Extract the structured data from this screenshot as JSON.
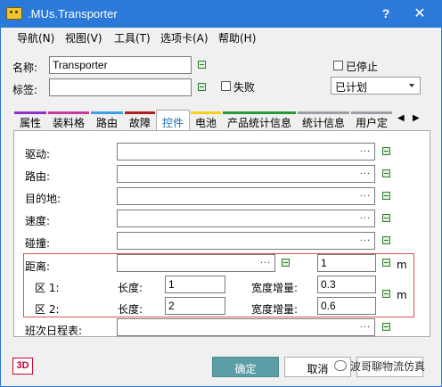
{
  "window": {
    "title": ".MUs.Transporter",
    "help_label": "?",
    "close_label": "✕"
  },
  "menu": [
    {
      "label": "导航(N)"
    },
    {
      "label": "视图(V)"
    },
    {
      "label": "工具(T)"
    },
    {
      "label": "选项卡(A)"
    },
    {
      "label": "帮助(H)"
    }
  ],
  "form": {
    "name_label": "名称:",
    "name_value": "Transporter",
    "tag_label": "标签:",
    "tag_value": "",
    "failed_label": "失败",
    "stopped_label": "已停止",
    "plan_value": "已计划"
  },
  "tabs": [
    {
      "label": "属性",
      "color": "#8e2fc9"
    },
    {
      "label": "装料格",
      "color": "#c83a9c"
    },
    {
      "label": "路由",
      "color": "#3ea0e8"
    },
    {
      "label": "故障",
      "color": "#b02020"
    },
    {
      "label": "控件",
      "color": "",
      "active": true
    },
    {
      "label": "电池",
      "color": "#f2d21b"
    },
    {
      "label": "产品统计信息",
      "color": "#2b9a3a"
    },
    {
      "label": "统计信息",
      "color": "#9aa0a6"
    },
    {
      "label": "用户定",
      "color": "#9aa0a6"
    }
  ],
  "tab_nav": {
    "prev": "◀",
    "next": "▶"
  },
  "controls": {
    "drive_label": "驱动:",
    "route_label": "路由:",
    "destination_label": "目的地:",
    "speed_label": "速度:",
    "collision_label": "碰撞:",
    "distance_label": "距离:",
    "distance_value": "1",
    "distance_unit": "m",
    "zone1_label": "区 1:",
    "zone1_length_label": "长度:",
    "zone1_length_value": "1",
    "zone1_width_label": "宽度增量:",
    "zone1_width_value": "0.3",
    "zone2_label": "区 2:",
    "zone2_length_label": "长度:",
    "zone2_length_value": "2",
    "zone2_width_label": "宽度增量:",
    "zone2_width_value": "0.6",
    "zones_unit": "m",
    "shift_label": "班次日程表:",
    "dots": "..."
  },
  "footer": {
    "badge": "3D",
    "ok_label": "确定",
    "cancel_label": "取消",
    "apply_label": "应用",
    "watermark": "波哥聊物流仿真"
  }
}
